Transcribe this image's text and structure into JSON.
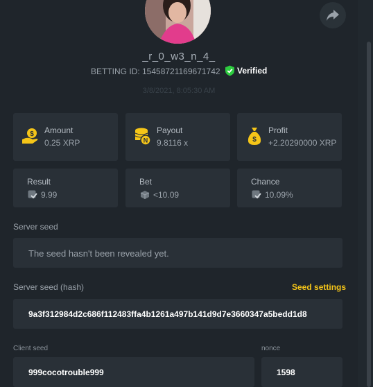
{
  "user": {
    "name": "_r_0_w3_n_4_",
    "bet_id_label": "BETTING ID: 15458721169671742",
    "verified_label": "Verified"
  },
  "timestamp": "3/8/2021, 8:05:30 AM",
  "stats": {
    "amount": {
      "label": "Amount",
      "value": "0.25 XRP"
    },
    "payout": {
      "label": "Payout",
      "value": "9.8116 x"
    },
    "profit": {
      "label": "Profit",
      "value": "+2.20290000 XRP"
    },
    "result": {
      "label": "Result",
      "value": "9.99"
    },
    "bet": {
      "label": "Bet",
      "value": "<10.09"
    },
    "chance": {
      "label": "Chance",
      "value": "10.09%"
    }
  },
  "server_seed": {
    "label": "Server seed",
    "value": "The seed hasn't been revealed yet."
  },
  "server_seed_hash": {
    "label": "Server seed (hash)",
    "settings_link": "Seed settings",
    "value": "9a3f312984d2c686f112483ffa4b1261a497b141d9d7e3660347a5bedd1d8"
  },
  "client_seed": {
    "label": "Client seed",
    "value": "999cocotrouble999"
  },
  "nonce": {
    "label": "nonce",
    "value": "1598"
  },
  "colors": {
    "accent": "#f5c518",
    "verified": "#2ecc40",
    "card": "#293037",
    "bg": "#1f252b"
  }
}
